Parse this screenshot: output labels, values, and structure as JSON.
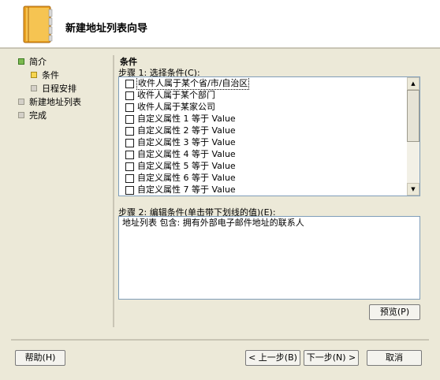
{
  "header": {
    "title": "新建地址列表向导"
  },
  "nav": {
    "items": [
      {
        "label": "简介"
      },
      {
        "label": "条件"
      },
      {
        "label": "日程安排"
      },
      {
        "label": "新建地址列表"
      },
      {
        "label": "完成"
      }
    ]
  },
  "content": {
    "section_title": "条件",
    "step1_label": "步骤 1: 选择条件(C):",
    "conditions": [
      "收件人属于某个省/市/自治区",
      "收件人属于某个部门",
      "收件人属于某家公司",
      "自定义属性 1 等于 Value",
      "自定义属性 2 等于 Value",
      "自定义属性 3 等于 Value",
      "自定义属性 4 等于 Value",
      "自定义属性 5 等于 Value",
      "自定义属性 6 等于 Value",
      "自定义属性 7 等于 Value"
    ],
    "step2_label": "步骤 2: 编辑条件(单击带下划线的值)(E):",
    "condition_text": "地址列表 包含: 拥有外部电子邮件地址的联系人"
  },
  "buttons": {
    "preview": "预览(P)",
    "help": "帮助(H)",
    "back": "< 上一步(B)",
    "next": "下一步(N) >",
    "cancel": "取消"
  }
}
